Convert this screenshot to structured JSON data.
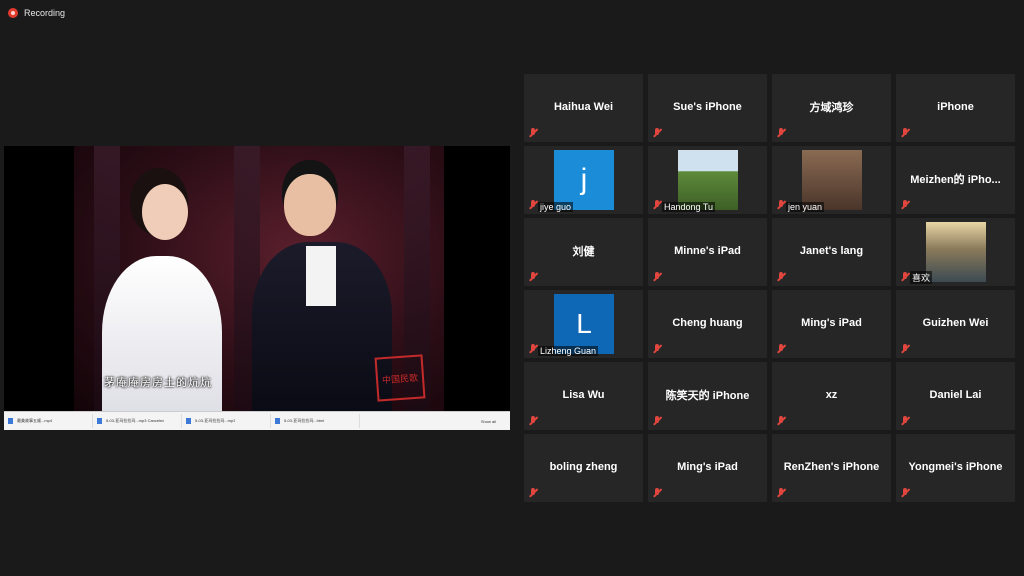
{
  "recording": {
    "label": "Recording"
  },
  "video": {
    "subtitle": "茅庵庵房房土的炕炕",
    "seal": "中国民歌",
    "downloads": [
      {
        "name": "最美故事五顺...mp4",
        "status": ""
      },
      {
        "name": "5-03-亚玛拉拉玛...mp3",
        "status": "Canceled"
      },
      {
        "name": "5-03-亚玛拉拉玛...mp3",
        "status": ""
      },
      {
        "name": "5-03-亚玛拉拉玛...html",
        "status": ""
      }
    ],
    "show_all": "Show all"
  },
  "participants": [
    {
      "name": "Haihua Wei",
      "type": "name"
    },
    {
      "name": "Sue's iPhone",
      "type": "name"
    },
    {
      "name": "方域鸿珍",
      "type": "name"
    },
    {
      "name": "iPhone",
      "type": "name"
    },
    {
      "name": "jiye guo",
      "type": "avatar",
      "avatar": "j"
    },
    {
      "name": "Handong Tu",
      "type": "photo",
      "photo": "pagoda"
    },
    {
      "name": "jen yuan",
      "type": "photo",
      "photo": "lantern"
    },
    {
      "name": "Meizhen的 iPho...",
      "type": "name"
    },
    {
      "name": "刘健",
      "type": "name"
    },
    {
      "name": "Minne's iPad",
      "type": "name"
    },
    {
      "name": "Janet's lang",
      "type": "name"
    },
    {
      "name": "喜欢",
      "type": "photo",
      "photo": "water"
    },
    {
      "name": "Lizheng Guan",
      "type": "avatar",
      "avatar": "L"
    },
    {
      "name": "Cheng huang",
      "type": "name"
    },
    {
      "name": "Ming's iPad",
      "type": "name"
    },
    {
      "name": "Guizhen Wei",
      "type": "name"
    },
    {
      "name": "Lisa Wu",
      "type": "name"
    },
    {
      "name": "陈笑天的 iPhone",
      "type": "name"
    },
    {
      "name": "xz",
      "type": "name"
    },
    {
      "name": "Daniel Lai",
      "type": "name"
    },
    {
      "name": "boling zheng",
      "type": "name"
    },
    {
      "name": "Ming's iPad",
      "type": "name"
    },
    {
      "name": "RenZhen's iPhone",
      "type": "name"
    },
    {
      "name": "Yongmei's iPhone",
      "type": "name"
    }
  ],
  "colors": {
    "muted_mic": "#e0463f",
    "tile_bg": "#262626",
    "background": "#1a1a1a"
  }
}
